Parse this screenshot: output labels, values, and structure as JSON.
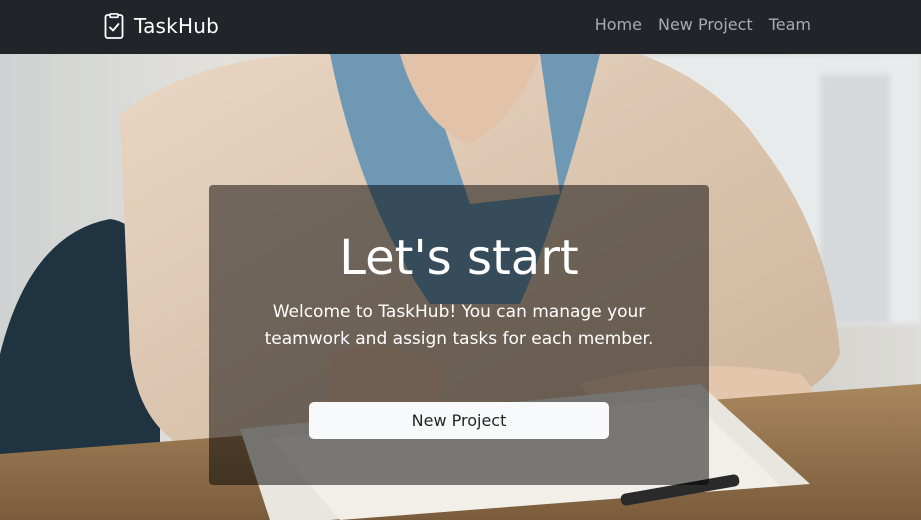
{
  "navbar": {
    "brand": "TaskHub",
    "brand_icon": "clipboard-check-icon",
    "links": [
      {
        "label": "Home"
      },
      {
        "label": "New Project"
      },
      {
        "label": "Team"
      }
    ]
  },
  "hero": {
    "title": "Let's start",
    "text": "Welcome to TaskHub! You can manage your teamwork and assign tasks for each member.",
    "button_label": "New Project"
  },
  "colors": {
    "navbar_bg": "#212529",
    "nav_link": "#a8abae",
    "card_overlay": "rgba(0,0,0,0.5)",
    "button_bg": "#f8f9fa"
  }
}
